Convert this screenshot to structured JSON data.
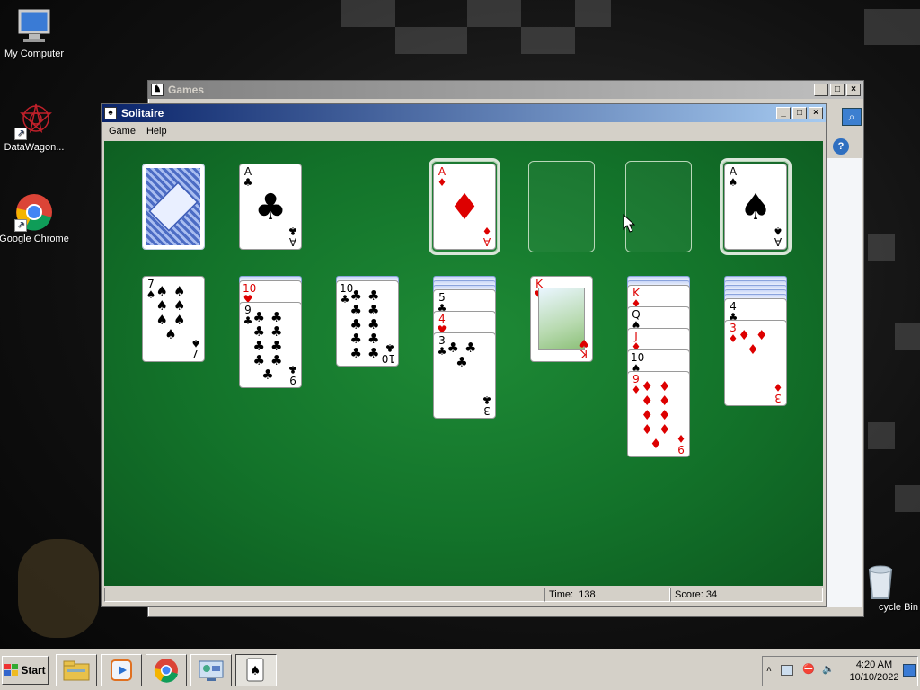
{
  "desktop": {
    "icons": [
      {
        "label": "My Computer",
        "icon": "computer-icon"
      },
      {
        "label": "DataWagon...",
        "icon": "datawagon-icon"
      },
      {
        "label": "Google Chrome",
        "icon": "chrome-icon"
      },
      {
        "label": "cycle Bin",
        "icon": "recycle-bin-icon"
      }
    ]
  },
  "games_window": {
    "title": "Games"
  },
  "solitaire": {
    "title": "Solitaire",
    "menu": [
      "Game",
      "Help"
    ],
    "stock_waste": {
      "waste_top": {
        "rank": "A",
        "suit": "♣"
      }
    },
    "foundations": [
      {
        "rank": "A",
        "suit": "♦"
      },
      null,
      null,
      {
        "rank": "A",
        "suit": "♠"
      }
    ],
    "tableau": [
      {
        "hidden": 0,
        "visible": [
          {
            "rank": "7",
            "suit": "♠"
          }
        ]
      },
      {
        "hidden": 1,
        "visible": [
          {
            "rank": "10",
            "suit": "♥"
          },
          {
            "rank": "9",
            "suit": "♣"
          }
        ]
      },
      {
        "hidden": 1,
        "visible": [
          {
            "rank": "10",
            "suit": "♣"
          }
        ]
      },
      {
        "hidden": 3,
        "visible": [
          {
            "rank": "5",
            "suit": "♣"
          },
          {
            "rank": "4",
            "suit": "♥"
          },
          {
            "rank": "3",
            "suit": "♣"
          }
        ]
      },
      {
        "hidden": 0,
        "visible": [
          {
            "rank": "K",
            "suit": "♥"
          }
        ]
      },
      {
        "hidden": 2,
        "visible": [
          {
            "rank": "K",
            "suit": "♦"
          },
          {
            "rank": "Q",
            "suit": "♠"
          },
          {
            "rank": "J",
            "suit": "♦"
          },
          {
            "rank": "10",
            "suit": "♠"
          },
          {
            "rank": "9",
            "suit": "♦"
          }
        ]
      },
      {
        "hidden": 5,
        "visible": [
          {
            "rank": "4",
            "suit": "♣"
          },
          {
            "rank": "3",
            "suit": "♦"
          }
        ]
      }
    ],
    "status": {
      "time_label": "Time:",
      "time_value": "138",
      "score_label": "Score:",
      "score_value": "34"
    }
  },
  "taskbar": {
    "start_label": "Start",
    "buttons": [
      "explorer-icon",
      "media-icon",
      "chrome-icon",
      "games-explorer-icon",
      "solitaire-icon"
    ],
    "clock_time": "4:20 AM",
    "clock_date": "10/10/2022"
  },
  "colors": {
    "felt": "#13732a",
    "title_active": "#0a246a",
    "red_suit": "#d00"
  }
}
